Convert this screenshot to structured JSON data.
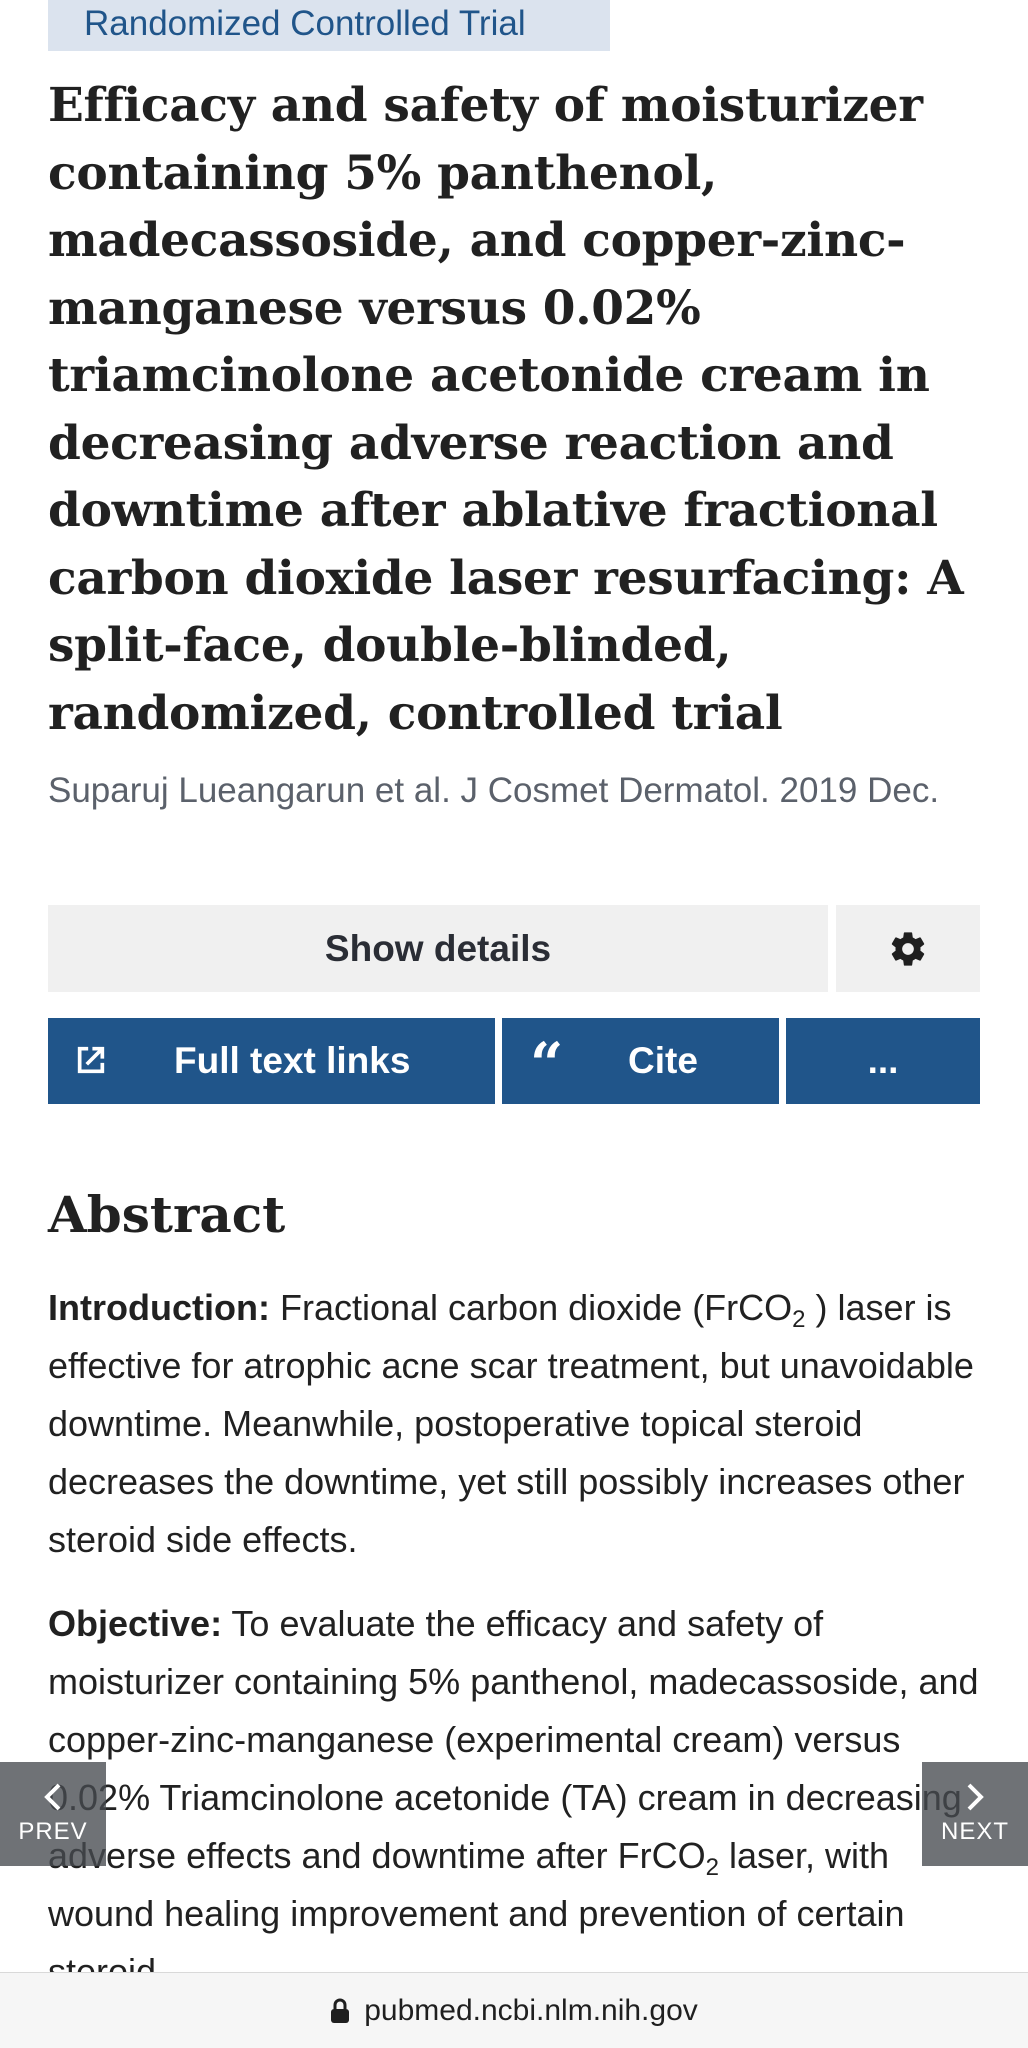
{
  "article": {
    "publication_type": "Randomized Controlled Trial",
    "title": "Efficacy and safety of moisturizer containing 5% panthenol, madecassoside, and copper-zinc-manganese versus 0.02% triamcinolone acetonide cream in decreasing adverse reaction and downtime after ablative fractional carbon dioxide laser resurfacing: A split-face, double-blinded, randomized, controlled trial",
    "citation": "Suparuj Lueangarun et al. J Cosmet Dermatol. 2019 Dec."
  },
  "buttons": {
    "show_details": "Show details",
    "settings_icon": "gear-icon",
    "full_text_links": "Full text links",
    "full_text_icon": "external-link-icon",
    "cite": "Cite",
    "cite_icon": "quote-icon",
    "more": "..."
  },
  "abstract": {
    "heading": "Abstract",
    "introduction": {
      "label": "Introduction:",
      "text_1": "Fractional carbon dioxide (FrCO",
      "sub": "2",
      "text_2": " ) laser is effective for atrophic acne scar treatment, but unavoidable downtime. Meanwhile, postoperative topical steroid decreases the downtime, yet still possibly increases other steroid side effects."
    },
    "objective": {
      "label": "Objective:",
      "text_1": "To evaluate the efficacy and safety of moisturizer containing 5% panthenol, madecassoside, and copper-zinc-manganese (experimental cream) versus 0.02% Triamcinolone acetonide (TA) cream in decreasing adverse effects and downtime after FrCO",
      "sub": "2",
      "text_2": " laser, with wound healing improvement and prevention of certain steroid-"
    }
  },
  "navigation": {
    "prev": "PREV",
    "next": "NEXT"
  },
  "browser": {
    "url": "pubmed.ncbi.nlm.nih.gov",
    "lock_icon": "lock-icon"
  },
  "colors": {
    "primary_blue": "#20558a",
    "tag_background": "#dbe3ee",
    "button_gray": "#f0f0f0"
  }
}
